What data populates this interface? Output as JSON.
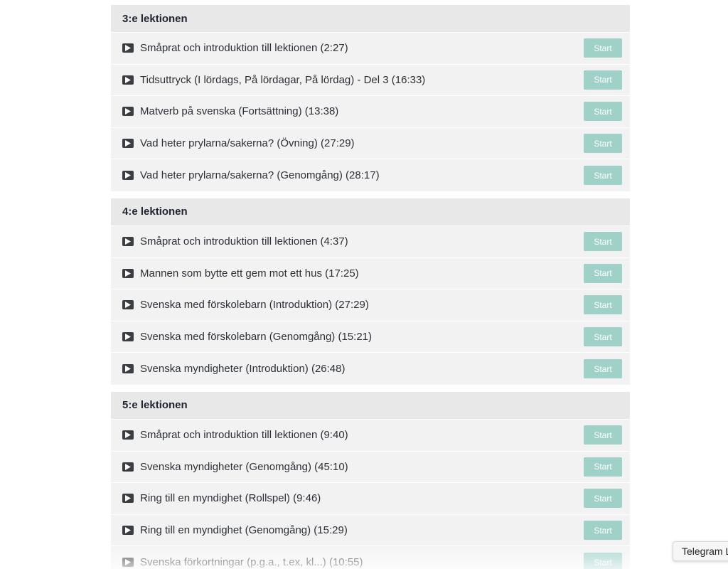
{
  "accent_color": "#9fd1c9",
  "play_icon": "play-video-icon",
  "sections": [
    {
      "title": "3:e lektionen",
      "lessons": [
        {
          "title": "Småprat och introduktion till lektionen (2:27)",
          "button": "Start"
        },
        {
          "title": "Tidsuttryck (I lördags, På lördagar, På lördag) - Del 3 (16:33)",
          "button": "Start"
        },
        {
          "title": "Matverb på svenska (Fortsättning) (13:38)",
          "button": "Start"
        },
        {
          "title": "Vad heter prylarna/sakerna? (Övning) (27:29)",
          "button": "Start"
        },
        {
          "title": "Vad heter prylarna/sakerna? (Genomgång) (28:17)",
          "button": "Start"
        }
      ]
    },
    {
      "title": "4:e lektionen",
      "lessons": [
        {
          "title": "Småprat och introduktion till lektionen (4:37)",
          "button": "Start"
        },
        {
          "title": "Mannen som bytte ett gem mot ett hus (17:25)",
          "button": "Start"
        },
        {
          "title": "Svenska med förskolebarn (Introduktion) (27:29)",
          "button": "Start"
        },
        {
          "title": "Svenska med förskolebarn (Genomgång) (15:21)",
          "button": "Start"
        },
        {
          "title": "Svenska myndigheter (Introduktion) (26:48)",
          "button": "Start"
        }
      ]
    },
    {
      "title": "5:e lektionen",
      "lessons": [
        {
          "title": "Småprat och introduktion till lektionen (9:40)",
          "button": "Start"
        },
        {
          "title": "Svenska myndigheter (Genomgång) (45:10)",
          "button": "Start"
        },
        {
          "title": "Ring till en myndighet (Rollspel) (9:46)",
          "button": "Start"
        },
        {
          "title": "Ring till en myndighet (Genomgång) (15:29)",
          "button": "Start"
        },
        {
          "title": "Svenska förkortningar (p.g.a., t.ex, kl...) (10:55)",
          "button": "Start"
        }
      ]
    }
  ],
  "popup": {
    "text": "Telegram L"
  }
}
